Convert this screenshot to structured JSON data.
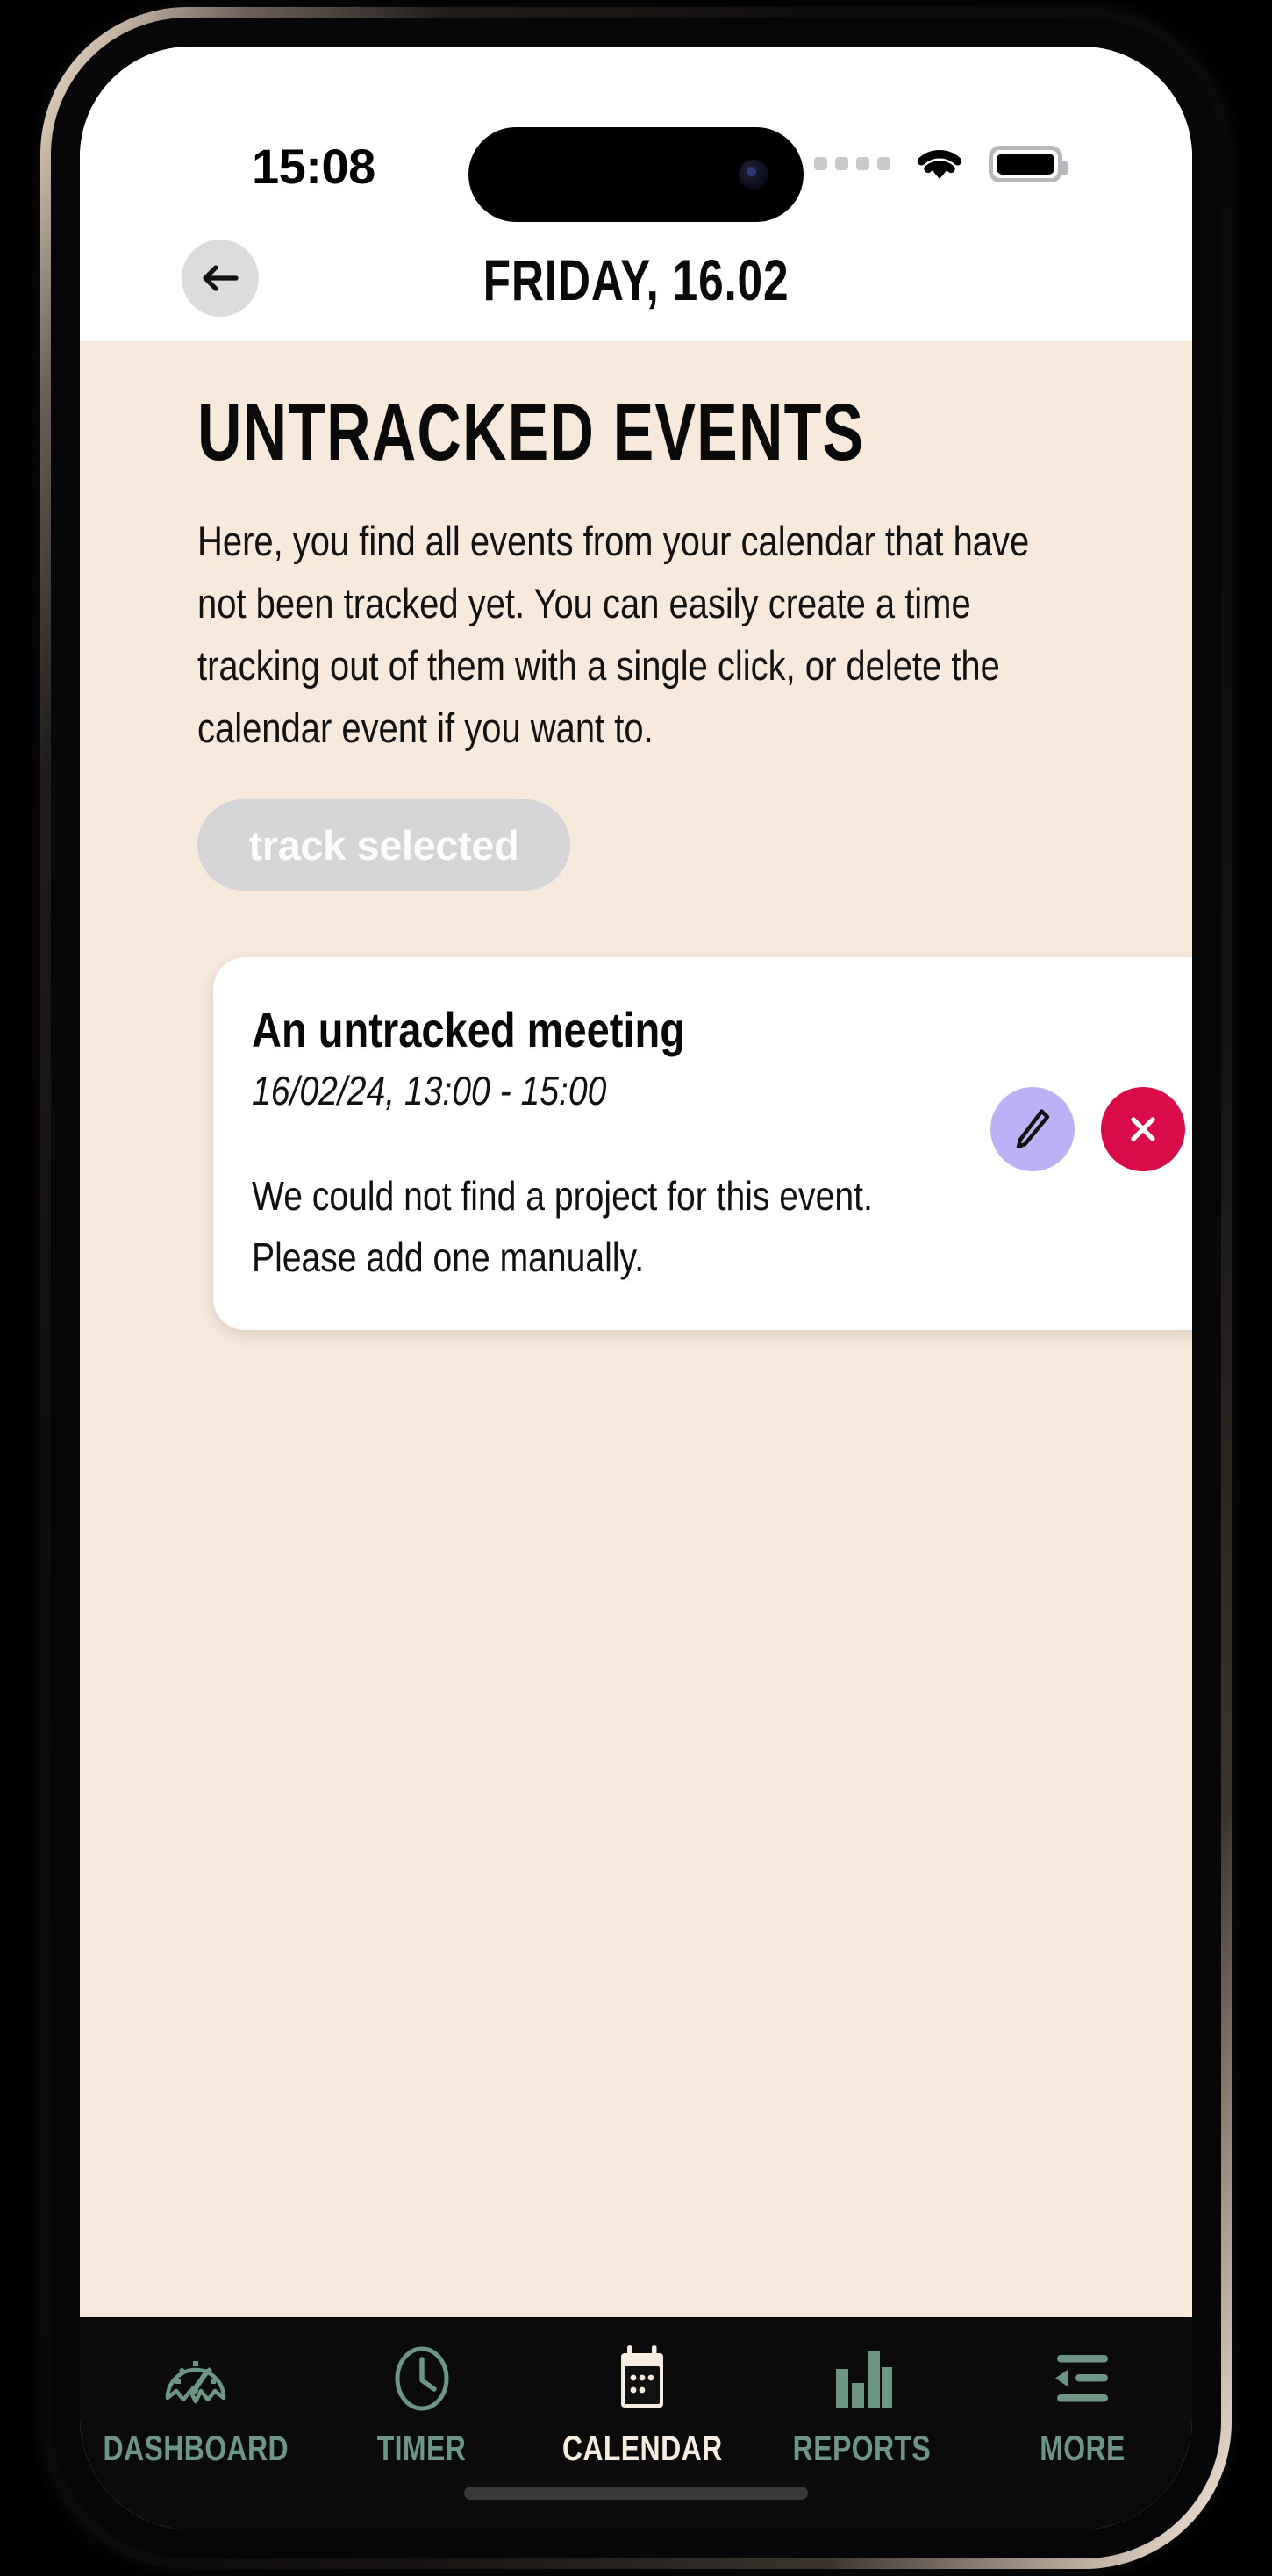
{
  "status_bar": {
    "time": "15:08",
    "signal_icon": "signal-dots-icon",
    "wifi_icon": "wifi-icon",
    "battery_icon": "battery-full-icon"
  },
  "header": {
    "back_icon": "arrow-left-icon",
    "title": "FRIDAY, 16.02"
  },
  "page": {
    "title": "UNTRACKED EVENTS",
    "description": "Here, you find all events from your calendar that have not been tracked yet. You can easily create a time tracking out of them with a single click, or delete the calendar event if you want to."
  },
  "actions": {
    "track_selected_label": "track selected",
    "track_selected_enabled": false
  },
  "events": [
    {
      "title": "An untracked meeting",
      "time": "16/02/24, 13:00 - 15:00",
      "note_line1": "We could not find a project for this event.",
      "note_line2": "Please add one manually.",
      "edit_icon": "pencil-icon",
      "delete_icon": "close-x-icon"
    }
  ],
  "bottom_nav": {
    "items": [
      {
        "label": "DASHBOARD",
        "icon": "gauge-icon",
        "active": false
      },
      {
        "label": "TIMER",
        "icon": "clock-icon",
        "active": false
      },
      {
        "label": "CALENDAR",
        "icon": "calendar-icon",
        "active": true
      },
      {
        "label": "REPORTS",
        "icon": "bar-chart-icon",
        "active": false
      },
      {
        "label": "MORE",
        "icon": "menu-back-icon",
        "active": false
      }
    ]
  },
  "colors": {
    "background": "#f7e9dc",
    "accent_green": "#6e9684",
    "accent_purple": "#bdb0f5",
    "accent_crimson": "#d90b48",
    "nav_background": "#0b0b0b",
    "active_label": "#f6ecdf",
    "disabled_button": "#d5d5d7"
  }
}
